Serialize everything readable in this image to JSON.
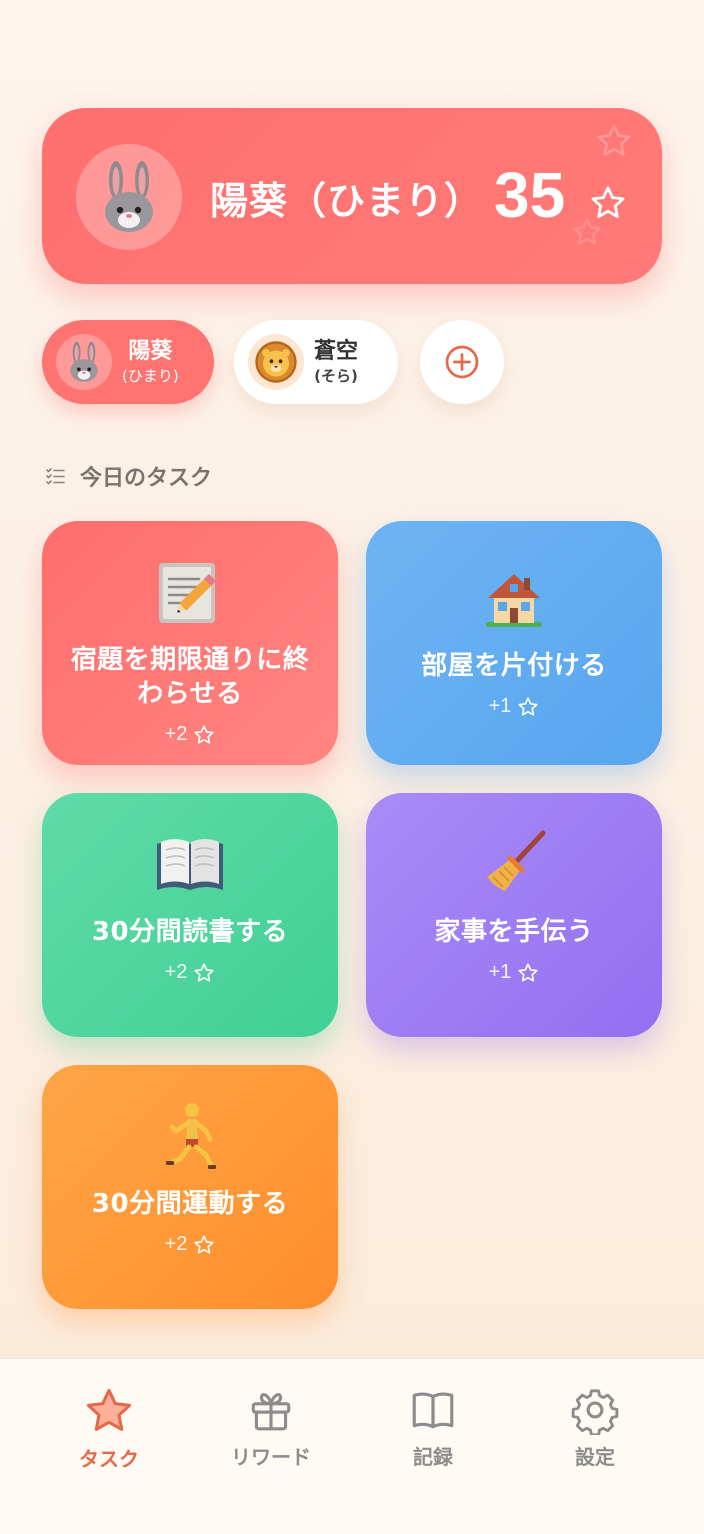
{
  "profile": {
    "avatar_icon": "rabbit-icon",
    "name": "陽葵（ひまり）",
    "points": "35",
    "star_icon": "star-outline-icon"
  },
  "children": [
    {
      "name": "陽葵",
      "reading": "(ひまり)",
      "avatar_icon": "rabbit-icon",
      "active": true
    },
    {
      "name": "蒼空",
      "reading": "(そら)",
      "avatar_icon": "lion-icon",
      "active": false
    }
  ],
  "add_child_icon": "plus-circle-icon",
  "tasks_section": {
    "icon": "checklist-icon",
    "title": "今日のタスク"
  },
  "tasks": [
    {
      "title": "宿題を期限通りに終わらせる",
      "points": "+2",
      "icon": "memo-pencil-icon",
      "color": "#ff7370"
    },
    {
      "title": "部屋を片付ける",
      "points": "+1",
      "icon": "house-icon",
      "color": "#63aef2"
    },
    {
      "title": "30分間読書する",
      "points": "+2",
      "icon": "open-book-icon",
      "color": "#4fd59e"
    },
    {
      "title": "家事を手伝う",
      "points": "+1",
      "icon": "broom-icon",
      "color": "#9e7ef4"
    },
    {
      "title": "30分間運動する",
      "points": "+2",
      "icon": "runner-icon",
      "color": "#ff9a3a"
    }
  ],
  "nav": [
    {
      "label": "タスク",
      "icon": "star-icon",
      "active": true
    },
    {
      "label": "リワード",
      "icon": "gift-icon",
      "active": false
    },
    {
      "label": "記録",
      "icon": "book-icon",
      "active": false
    },
    {
      "label": "設定",
      "icon": "gear-icon",
      "active": false
    }
  ],
  "colors": {
    "accent": "#ff6f6f",
    "nav_active": "#e56849",
    "nav_inactive": "#8c8c8c",
    "background": "#fdf1e6"
  }
}
